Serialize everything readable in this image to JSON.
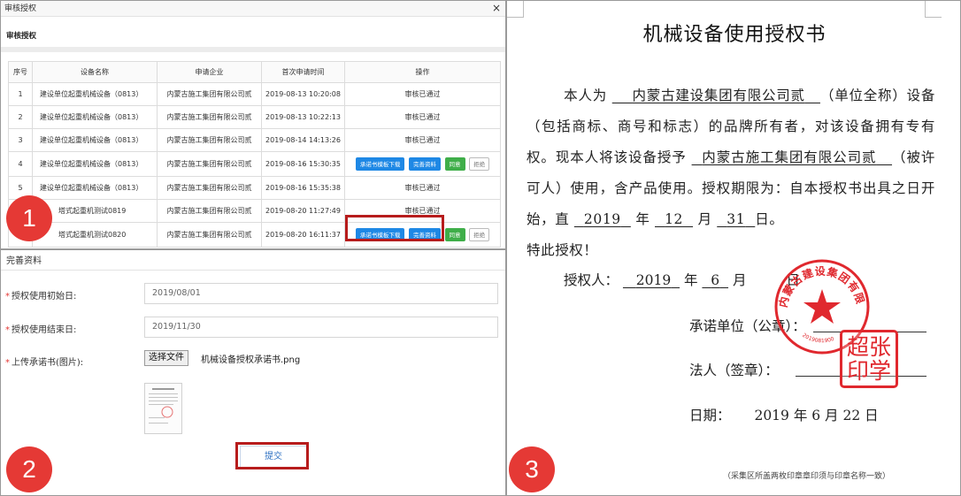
{
  "panel1": {
    "window_title": "审核授权",
    "close_glyph": "×",
    "section_title": "审核授权",
    "columns": [
      "序号",
      "设备名称",
      "申请企业",
      "首次申请时间",
      "操作"
    ],
    "rows": [
      {
        "no": "1",
        "device": "建设单位起重机械设备（0813）",
        "company": "内蒙古施工集团有限公司贰",
        "time": "2019-08-13 10:20:08",
        "status": "审核已通过"
      },
      {
        "no": "2",
        "device": "建设单位起重机械设备（0813）",
        "company": "内蒙古施工集团有限公司贰",
        "time": "2019-08-13 10:22:13",
        "status": "审核已通过"
      },
      {
        "no": "3",
        "device": "建设单位起重机械设备（0813）",
        "company": "内蒙古施工集团有限公司贰",
        "time": "2019-08-14 14:13:26",
        "status": "审核已通过"
      },
      {
        "no": "4",
        "device": "建设单位起重机械设备（0813）",
        "company": "内蒙古施工集团有限公司贰",
        "time": "2019-08-16 15:30:35",
        "status": ""
      },
      {
        "no": "5",
        "device": "建设单位起重机械设备（0813）",
        "company": "内蒙古施工集团有限公司贰",
        "time": "2019-08-16 15:35:38",
        "status": "审核已通过"
      },
      {
        "no": "",
        "device": "塔式起重机测试0819",
        "company": "内蒙古施工集团有限公司贰",
        "time": "2019-08-20 11:27:49",
        "status": "审核已通过"
      },
      {
        "no": "",
        "device": "塔式起重机测试0820",
        "company": "内蒙古施工集团有限公司贰",
        "time": "2019-08-20 16:11:37",
        "status": ""
      }
    ],
    "actions": {
      "template_download": "承诺书模板下载",
      "complete_info": "完善资料",
      "approve": "同意",
      "reject": "拒绝"
    },
    "step_number": "1"
  },
  "panel2": {
    "header": "完善资料",
    "required_mark": "*",
    "start_label": "授权使用初始日:",
    "start_value": "2019/08/01",
    "end_label": "授权使用结束日:",
    "end_value": "2019/11/30",
    "upload_label": "上传承诺书(图片):",
    "choose_file": "选择文件",
    "file_name": "机械设备授权承诺书.png",
    "submit": "提交",
    "step_number": "2"
  },
  "panel3": {
    "title": "机械设备使用授权书",
    "p1": "本人为",
    "company_owner": "内蒙古建设集团有限公司贰",
    "p2": "（单位全称）设备（包括商标、商号和标志）的品牌所有者，对该设备拥有专有权。现本人将该设备授予",
    "company_licensee": "内蒙古施工集团有限公司贰",
    "p3": "（被许可人）使用，含产品使用。授权期限为：自本授权书出具之日开始，直",
    "end_year": "2019",
    "year_char": "年",
    "end_month": "12",
    "month_char": "月",
    "end_day": "31",
    "day_char": "日。",
    "p4": "特此授权！",
    "grantor_label": "授权人：",
    "grant_year": "2019",
    "grant_month": "6",
    "grant_day_char": "日",
    "unit_label": "承诺单位（公章）：",
    "legal_label": "法人（签章）：",
    "date_label": "日期：",
    "date_value": "2019 年 6  月 22 日",
    "seal_text": "内蒙古建设集团有限公司",
    "seal_number": "2019081900",
    "sig_line1": "超张",
    "sig_line2": "印学",
    "note": "（采集区所盖两枚印章章印须与印章名称一致）",
    "step_number": "3"
  },
  "colors": {
    "accent_blue": "#1e88e5",
    "approve_green": "#3fae49",
    "highlight_red": "#b71c1c",
    "badge_red": "#e53935",
    "seal_red": "#e0282e"
  }
}
